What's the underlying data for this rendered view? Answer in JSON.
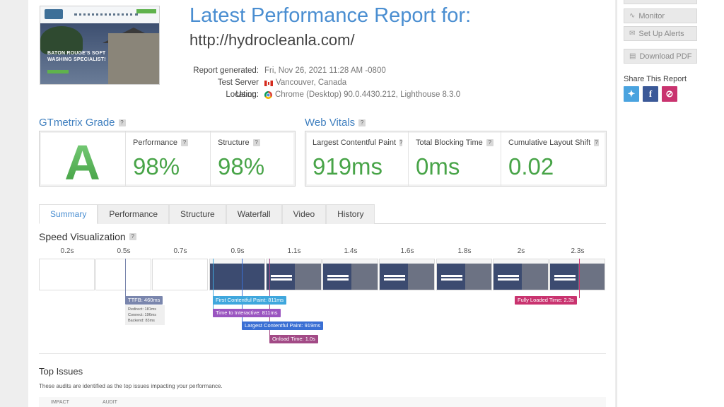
{
  "report": {
    "title": "Latest Performance Report for:",
    "url": "http://hydrocleanla.com/",
    "thumbnail_headline": "BATON ROUGE'S SOFT WASHING SPECIALIST!",
    "meta": [
      {
        "label": "Report generated:",
        "value": "Fri, Nov 26, 2021 11:28 AM -0800",
        "icon": ""
      },
      {
        "label": "Test Server Location:",
        "value": "Vancouver, Canada",
        "icon": "canada-flag-icon"
      },
      {
        "label": "Using:",
        "value": "Chrome (Desktop) 90.0.4430.212, Lighthouse 8.3.0",
        "icon": "chrome-icon"
      }
    ]
  },
  "grade": {
    "title": "GTmetrix Grade",
    "letter": "A",
    "performance_label": "Performance",
    "performance_value": "98%",
    "structure_label": "Structure",
    "structure_value": "98%"
  },
  "vitals": {
    "title": "Web Vitals",
    "lcp_label": "Largest Contentful Paint",
    "lcp_value": "919ms",
    "tbt_label": "Total Blocking Time",
    "tbt_value": "0ms",
    "cls_label": "Cumulative Layout Shift",
    "cls_value": "0.02"
  },
  "help_glyph": "?",
  "tabs": [
    "Summary",
    "Performance",
    "Structure",
    "Waterfall",
    "Video",
    "History"
  ],
  "active_tab": 0,
  "speed": {
    "title": "Speed Visualization",
    "ticks": [
      "0.2s",
      "0.5s",
      "0.7s",
      "0.9s",
      "1.1s",
      "1.4s",
      "1.6s",
      "1.8s",
      "2s",
      "2.3s"
    ],
    "ttfb": {
      "label": "TTFB: 460ms",
      "color": "#7a86ad"
    },
    "ttfb_details": [
      "Redirect: 181ms",
      "Connect: 196ms",
      "Backend: 83ms"
    ],
    "markers": [
      {
        "label": "First Contentful Paint: 811ms",
        "color": "#3fa7dd"
      },
      {
        "label": "Time to Interactive: 811ms",
        "color": "#9a55c0"
      },
      {
        "label": "Largest Contentful Paint: 919ms",
        "color": "#3a6fd4"
      },
      {
        "label": "Onload Time: 1.0s",
        "color": "#a24a86"
      },
      {
        "label": "Fully Loaded Time: 2.3s",
        "color": "#c9336f"
      }
    ]
  },
  "issues": {
    "title": "Top Issues",
    "description": "These audits are identified as the top issues impacting your performance.",
    "col_impact": "IMPACT",
    "col_audit": "AUDIT"
  },
  "sidebar": {
    "monitor_label": "Monitor",
    "alerts_label": "Set Up Alerts",
    "pdf_label": "Download PDF",
    "share_title": "Share This Report"
  }
}
